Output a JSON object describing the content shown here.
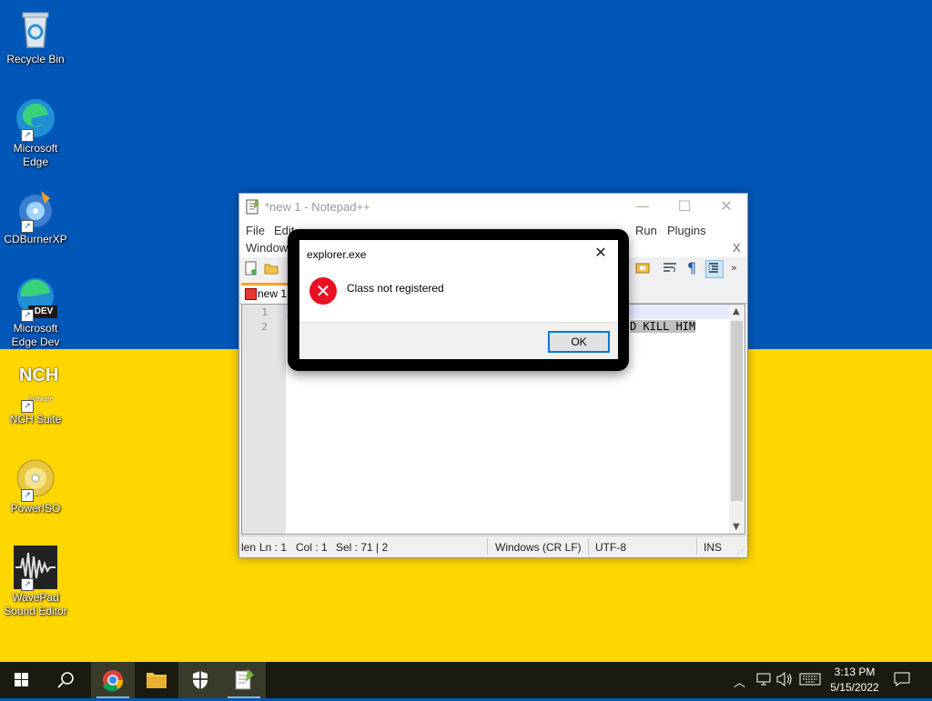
{
  "desktop": {
    "icons": [
      {
        "label": "Recycle Bin",
        "icon": "recycle-bin-icon"
      },
      {
        "label": "Microsoft Edge",
        "icon": "edge-icon"
      },
      {
        "label": "CDBurnerXP",
        "icon": "cd-burner-icon"
      },
      {
        "label": "Microsoft Edge Dev",
        "icon": "edge-dev-icon",
        "badge": "DEV"
      },
      {
        "label": "NCH Suite",
        "icon": "nch-icon",
        "badge_text": "NCH",
        "badge_sub": "Software"
      },
      {
        "label": "PowerISO",
        "icon": "poweriso-icon"
      },
      {
        "label": "WavePad Sound Editor",
        "icon": "wavepad-icon"
      }
    ],
    "flag_colors": {
      "top": "#0057b8",
      "bottom": "#ffd700"
    }
  },
  "notepad": {
    "title": "*new 1 - Notepad++",
    "menu": {
      "file": "File",
      "edit": "Edit",
      "run": "Run",
      "plugins": "Plugins",
      "window": "Window",
      "close_x": "X"
    },
    "tab": {
      "label": "new 1"
    },
    "lines": [
      {
        "num": "1",
        "text": ""
      },
      {
        "num": "2",
        "text": "D KILL HIM"
      }
    ],
    "status": {
      "length": "len",
      "ln": "Ln : 1",
      "col": "Col : 1",
      "sel": "Sel : 71 | 2",
      "eol": "Windows (CR LF)",
      "encoding": "UTF-8",
      "mode": "INS"
    }
  },
  "dialog": {
    "title": "explorer.exe",
    "message": "Class not registered",
    "ok_label": "OK",
    "close_glyph": "✕"
  },
  "taskbar": {
    "clock_time": "3:13 PM",
    "clock_date": "5/15/2022"
  }
}
